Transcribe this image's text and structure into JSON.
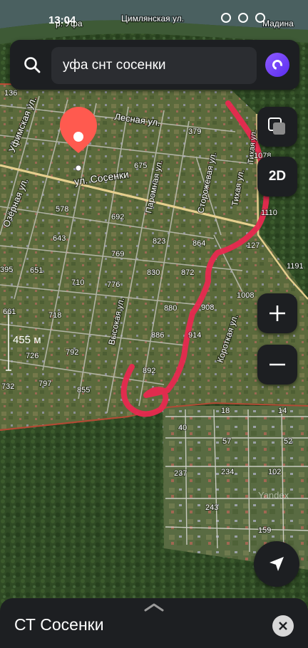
{
  "status_bar": {
    "time": "13:04",
    "icons": [
      "alarm-icon",
      "location-icon",
      "sim-icon",
      "signal-icon"
    ]
  },
  "search": {
    "query": "уфа снт сосенки",
    "icon": "search-icon",
    "assistant_icon": "alice-icon"
  },
  "map": {
    "scale_label": "455 м",
    "watermark": "Yandex",
    "place_labels": [
      {
        "text": "р. Уфа"
      },
      {
        "text": "Цимлянская ул."
      },
      {
        "text": "Мадина"
      },
      {
        "text": "Лесная ул."
      },
      {
        "text": "ул. Сосенки"
      },
      {
        "text": "Уфимская ул."
      },
      {
        "text": "Озёрная ул."
      },
      {
        "text": "Паромная ул."
      },
      {
        "text": "Сторожевая ул."
      },
      {
        "text": "Тихая ул."
      },
      {
        "text": "Тихая ул."
      },
      {
        "text": "Высокая ул."
      },
      {
        "text": "Короткая ул."
      }
    ],
    "house_numbers": [
      "136",
      "379",
      "1078",
      "675",
      "578",
      "692",
      "1110",
      "643",
      "823",
      "864",
      "127",
      "769",
      "1191",
      "651",
      "830",
      "872",
      "395",
      "710",
      "776",
      "1008",
      "880",
      "908",
      "661",
      "718",
      "886",
      "914",
      "792",
      "726",
      "892",
      "732",
      "797",
      "855",
      "18",
      "14",
      "40",
      "57",
      "52",
      "237",
      "234",
      "102",
      "243",
      "159"
    ],
    "colors": {
      "route": "#e8294f",
      "pin": "#ff5a4f",
      "boundary": "#c24a35",
      "road": "#e6cf8e"
    }
  },
  "controls": {
    "layers_icon": "layers-icon",
    "mode_label": "2D",
    "zoom_in_label": "+",
    "zoom_out_label": "−",
    "locate_icon": "navigation-arrow-icon"
  },
  "place_card": {
    "title": "СТ Сосенки",
    "close_icon": "close-icon"
  }
}
